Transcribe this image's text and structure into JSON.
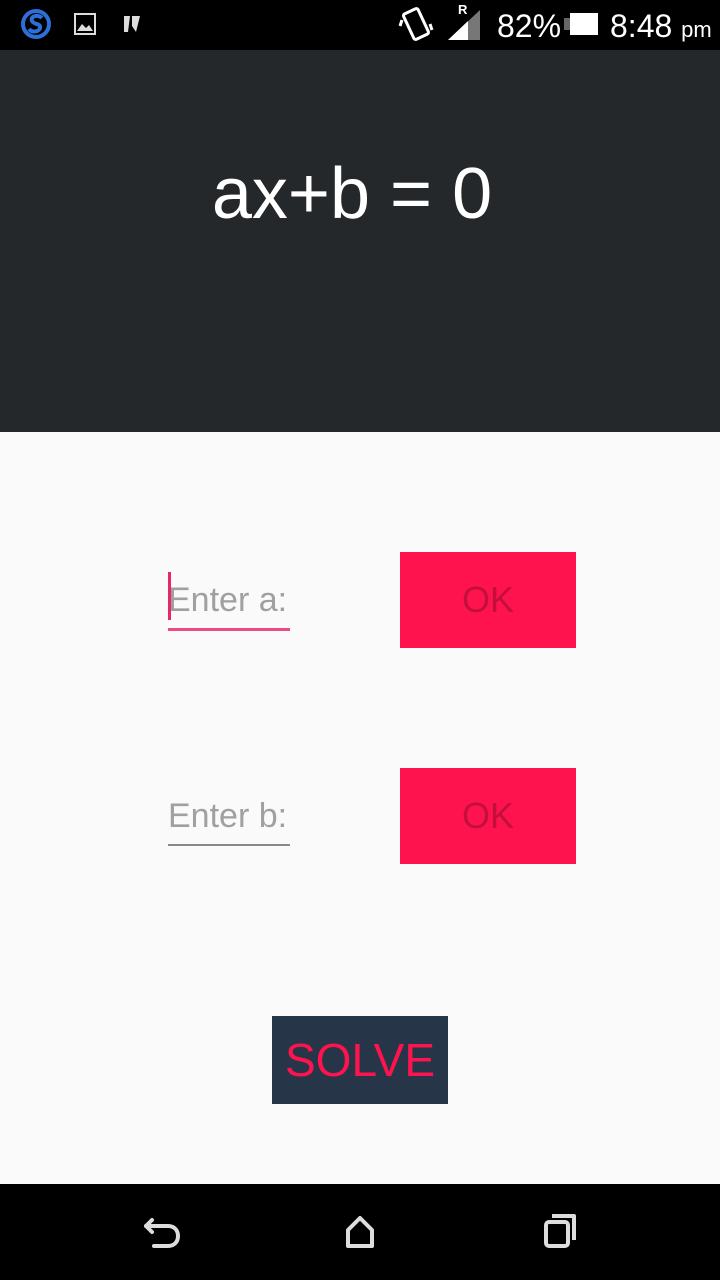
{
  "status_bar": {
    "battery_percent": "82%",
    "time": "8:48",
    "ampm": "pm",
    "roaming": "R",
    "icons": [
      "skype-icon",
      "gallery-icon",
      "notification-icon",
      "vibrate-icon",
      "signal-icon",
      "battery-icon"
    ]
  },
  "header": {
    "equation": "ax+b = 0"
  },
  "form": {
    "a_placeholder": "Enter a:",
    "b_placeholder": "Enter b:",
    "ok_a_label": "OK",
    "ok_b_label": "OK",
    "solve_label": "SOLVE"
  },
  "nav_bar": {
    "icons": [
      "back-icon",
      "home-icon",
      "recents-icon"
    ]
  },
  "colors": {
    "header_bg": "#24282b",
    "accent": "#ff134f",
    "solve_bg": "#263547",
    "page_bg": "#fafafa"
  }
}
